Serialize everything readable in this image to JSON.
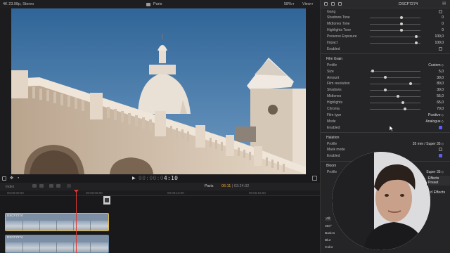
{
  "topbar": {
    "format": "4K 23.98p, Stereo",
    "title": "Paris",
    "zoom": "58%",
    "view": "View"
  },
  "transport": {
    "timecode_dim": "00:00:0",
    "timecode_main": "4:10"
  },
  "timeline": {
    "index_label": "Index",
    "project": "Paris",
    "duration_current": "06:11",
    "duration_total": "03:24:32",
    "ruler": [
      "00:00:00:00",
      "00:00:05:00",
      "00:00:10:00",
      "00:00:15:00",
      "00:00:20:00"
    ],
    "clips": [
      "DSCF7274",
      "DSCF7274"
    ]
  },
  "inspector": {
    "clip_name": "DSCF7274",
    "rows_top": [
      {
        "label": "Gang",
        "type": "check",
        "on": false
      },
      {
        "label": "Shadows Tone",
        "type": "slider",
        "value": "0",
        "pos": 0.62
      },
      {
        "label": "Midtones Tone",
        "type": "slider",
        "value": "0",
        "pos": 0.62
      },
      {
        "label": "Highlights Tone",
        "type": "slider",
        "value": "0",
        "pos": 0.62
      },
      {
        "label": "Preserve Exposure",
        "type": "slider",
        "value": "100,0",
        "pos": 0.92
      },
      {
        "label": "Impact",
        "type": "slider",
        "value": "100,0",
        "pos": 0.92
      },
      {
        "label": "Enabled",
        "type": "check",
        "on": false
      }
    ],
    "grain_title": "Film Grain",
    "grain_rows": [
      {
        "label": "Profile",
        "type": "dropdown",
        "value": "Custom"
      },
      {
        "label": "Size",
        "type": "slider",
        "value": "5,0",
        "pos": 0.05
      },
      {
        "label": "Amount",
        "type": "slider",
        "value": "30,0",
        "pos": 0.3
      },
      {
        "label": "Film resolution",
        "type": "slider",
        "value": "80,0",
        "pos": 0.8
      },
      {
        "label": "Shadows",
        "type": "slider",
        "value": "30,0",
        "pos": 0.3
      },
      {
        "label": "Midtones",
        "type": "slider",
        "value": "55,0",
        "pos": 0.55
      },
      {
        "label": "Highlights",
        "type": "slider",
        "value": "65,0",
        "pos": 0.65
      },
      {
        "label": "Chroma",
        "type": "slider",
        "value": "70,0",
        "pos": 0.7
      },
      {
        "label": "Film type",
        "type": "dropdown",
        "value": "Positive"
      },
      {
        "label": "Mode",
        "type": "dropdown",
        "value": "Analogue"
      },
      {
        "label": "Enabled",
        "type": "check",
        "on": true
      }
    ],
    "halation_title": "Halation",
    "halation_rows": [
      {
        "label": "Profile",
        "type": "dropdown",
        "value": "35 mm / Super 35"
      },
      {
        "label": "Mask mode",
        "type": "check",
        "on": false
      },
      {
        "label": "Enabled",
        "type": "check",
        "on": true
      }
    ],
    "bloom_title": "Bloom",
    "bloom_rows": [
      {
        "label": "Profile",
        "type": "dropdown",
        "value": "Super 35"
      }
    ],
    "effects_preset": "Effects Preset",
    "effects_label": "d Effects",
    "side_items": [
      "All",
      "360°",
      "Basics",
      "Blur",
      "Color"
    ]
  }
}
